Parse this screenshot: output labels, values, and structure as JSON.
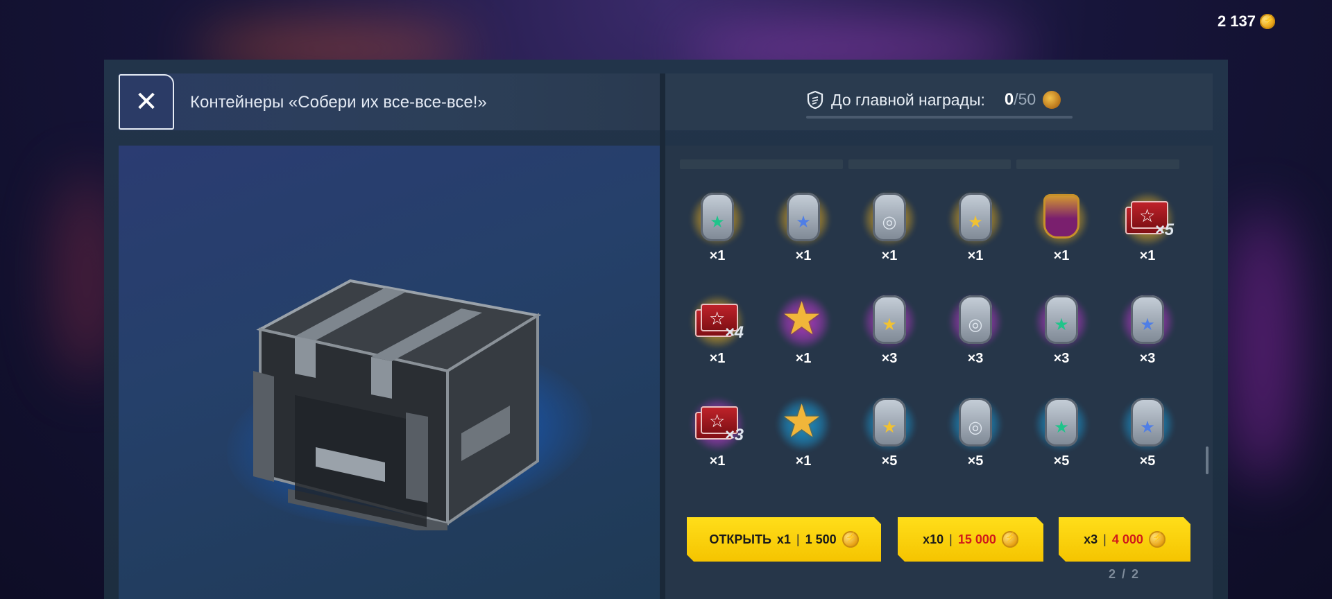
{
  "balance": {
    "amount": "2 137",
    "icon": "gold-coin-icon"
  },
  "header": {
    "close_icon": "close-icon",
    "title": "Контейнеры «Собери их все-все-все!»",
    "reward_label": "До главной награды:",
    "reward_current": "0",
    "reward_total": "/50",
    "reward_progress": 0
  },
  "rewards": [
    {
      "type": "tag",
      "glow": "gold",
      "symbol": "★",
      "symbol_color": "#1fc48a",
      "icon": "crew-tag-icon",
      "qty": "×1"
    },
    {
      "type": "tag",
      "glow": "gold",
      "symbol": "★",
      "symbol_color": "#4f7ee6",
      "icon": "tank-tag-icon",
      "qty": "×1"
    },
    {
      "type": "tag",
      "glow": "gold",
      "symbol": "◎",
      "symbol_color": "#dfe6ee",
      "icon": "credits-tag-icon",
      "qty": "×1"
    },
    {
      "type": "tag",
      "glow": "gold",
      "symbol": "★",
      "symbol_color": "#f1c232",
      "icon": "tank-tag-icon",
      "qty": "×1"
    },
    {
      "type": "horse",
      "glow": "gold",
      "icon": "horseshoe-icon",
      "qty": "×1"
    },
    {
      "type": "cards",
      "glow": "gold",
      "mult": "×5",
      "icon": "cards-icon",
      "qty": "×1"
    },
    {
      "type": "cards",
      "glow": "gold",
      "mult": "×4",
      "icon": "cards-icon",
      "qty": "×1"
    },
    {
      "type": "bigstar",
      "glow": "purple",
      "icon": "star-badge-icon",
      "qty": "×1"
    },
    {
      "type": "tag",
      "glow": "purple",
      "symbol": "★",
      "symbol_color": "#f1c232",
      "icon": "tank-tag-icon",
      "qty": "×3"
    },
    {
      "type": "tag",
      "glow": "purple",
      "symbol": "◎",
      "symbol_color": "#dfe6ee",
      "icon": "credits-tag-icon",
      "qty": "×3"
    },
    {
      "type": "tag",
      "glow": "purple",
      "symbol": "★",
      "symbol_color": "#1fc48a",
      "icon": "crew-tag-icon",
      "qty": "×3"
    },
    {
      "type": "tag",
      "glow": "purple",
      "symbol": "★",
      "symbol_color": "#4f7ee6",
      "icon": "tank-tag-icon",
      "qty": "×3"
    },
    {
      "type": "cards",
      "glow": "purple",
      "mult": "×3",
      "icon": "cards-icon",
      "qty": "×1"
    },
    {
      "type": "bigstar",
      "glow": "cyan",
      "icon": "star-badge-icon",
      "qty": "×1"
    },
    {
      "type": "tag",
      "glow": "cyan",
      "symbol": "★",
      "symbol_color": "#f1c232",
      "icon": "tank-tag-icon",
      "qty": "×5"
    },
    {
      "type": "tag",
      "glow": "cyan",
      "symbol": "◎",
      "symbol_color": "#dfe6ee",
      "icon": "credits-tag-icon",
      "qty": "×5"
    },
    {
      "type": "tag",
      "glow": "cyan",
      "symbol": "★",
      "symbol_color": "#1fc48a",
      "icon": "crew-tag-icon",
      "qty": "×5"
    },
    {
      "type": "tag",
      "glow": "cyan",
      "symbol": "★",
      "symbol_color": "#4f7ee6",
      "icon": "tank-tag-icon",
      "qty": "×5"
    }
  ],
  "glow_colors": {
    "gold": "#f2b51e",
    "purple": "#c63ad8",
    "cyan": "#1aa6e6"
  },
  "buttons": {
    "open1": {
      "label": "ОТКРЫТЬ",
      "mult": "x1",
      "sep": "|",
      "price": "1 500"
    },
    "open10": {
      "mult": "x10",
      "sep": "|",
      "price": "15 000"
    },
    "open3": {
      "mult": "x3",
      "sep": "|",
      "price": "4 000"
    }
  },
  "pagination": "2 / 2",
  "accent_color": "#ffd60a"
}
